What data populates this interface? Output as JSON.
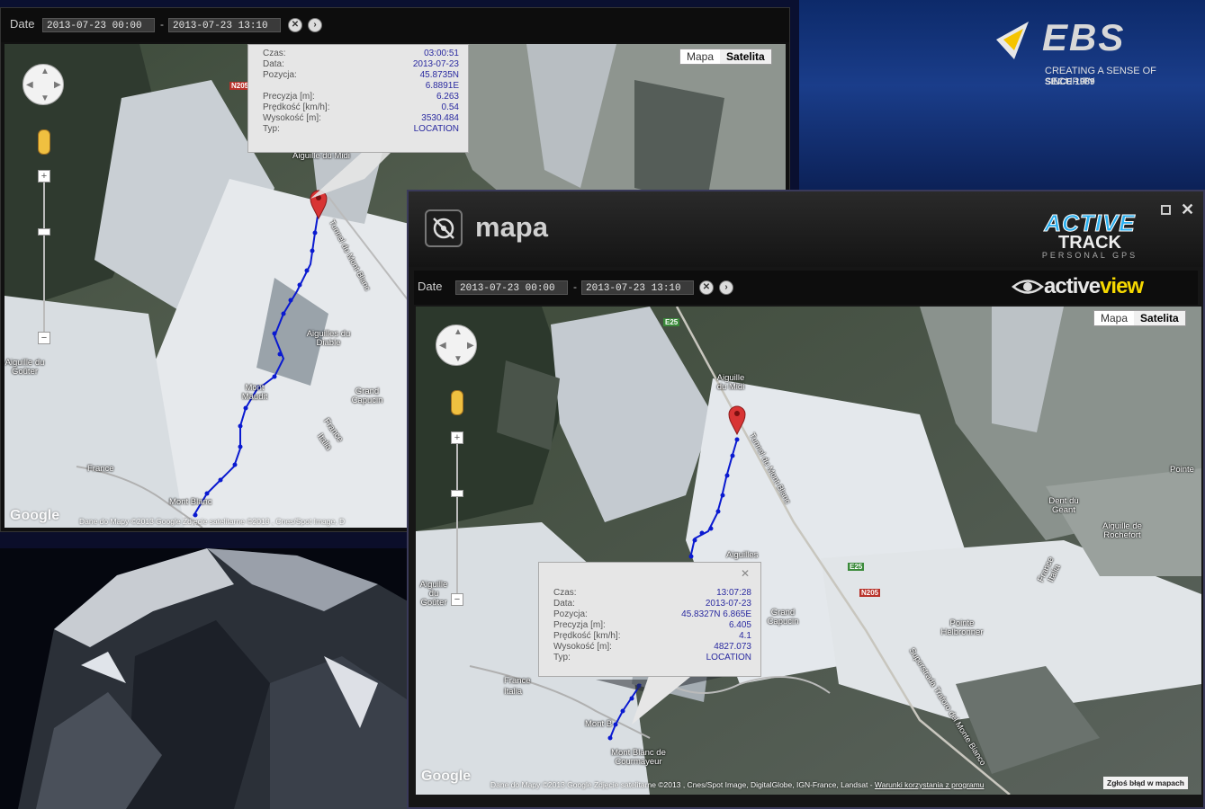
{
  "colors": {
    "accent": "#1020c8",
    "marker": "#d83434",
    "popup_bg": "#e6e6e6"
  },
  "brand": {
    "ebs_name": "EBS",
    "ebs_tagline": "CREATING A SENSE OF SECURITY",
    "ebs_since": "SINCE 1989"
  },
  "left_window": {
    "date_label": "Date",
    "date_from": "2013-07-23 00:00",
    "date_to": "2013-07-23 13:10",
    "dash": "-",
    "map_type": {
      "map": "Mapa",
      "satellite": "Satelita",
      "selected": "Satelita"
    },
    "popup": {
      "rows": [
        {
          "label": "Czas:",
          "value": "03:00:51"
        },
        {
          "label": "Data:",
          "value": "2013-07-23"
        },
        {
          "label": "Pozycja:",
          "value": "45.8735N"
        },
        {
          "label": "",
          "value": "6.8891E"
        },
        {
          "label": "Precyzja [m]:",
          "value": "6.263"
        },
        {
          "label": "Prędkość [km/h]:",
          "value": "0.54"
        },
        {
          "label": "Wysokość [m]:",
          "value": "3530.484"
        },
        {
          "label": "Typ:",
          "value": "LOCATION"
        }
      ]
    },
    "places": {
      "aiguille_midi": "Aiguille du Midi",
      "aiguilles_diable": "Aiguilles du Diable",
      "grand_capucin": "Grand Capucin",
      "aiguille_gouter": "Aiguille du Goûter",
      "mont_maudit": "Mont Maudit",
      "mont_blanc": "Mont Blanc",
      "france": "France",
      "italia": "Italia",
      "tunnel": "Tunnel du Mont-Blanc",
      "n205": "N205"
    },
    "google": "Google",
    "attribution": "Dane do Mapy ©2013 Google Zdjęcie satelitarne ©2013 , Cnes/Spot Image, D"
  },
  "main_window": {
    "title": "mapa",
    "logo_active": "ACTIVE",
    "logo_track": "TRACK",
    "logo_sub": "PERSONAL GPS",
    "activeview_1": "active",
    "activeview_2": "view",
    "date_label": "Date",
    "date_from": "2013-07-23 00:00",
    "date_to": "2013-07-23 13:10",
    "dash": "-",
    "map_type": {
      "map": "Mapa",
      "satellite": "Satelita",
      "selected": "Satelita"
    },
    "popup": {
      "rows": [
        {
          "label": "Czas:",
          "value": "13:07:28"
        },
        {
          "label": "Data:",
          "value": "2013-07-23"
        },
        {
          "label": "Pozycja:",
          "value": "45.8327N 6.865E"
        },
        {
          "label": "Precyzja [m]:",
          "value": "6.405"
        },
        {
          "label": "Prędkość [km/h]:",
          "value": "4.1"
        },
        {
          "label": "Wysokość [m]:",
          "value": "4827.073"
        },
        {
          "label": "Typ:",
          "value": "LOCATION"
        }
      ]
    },
    "places": {
      "aiguille_midi": "Aiguille du Midi",
      "aiguilles_diable": "Aiguilles",
      "grand_capucin": "Grand Capucin",
      "aiguille_gouter": "Aiguille du Goûter",
      "dent_geant": "Dent du Géant",
      "aiguille_rochefort": "Aiguille de Rochefort",
      "pointe_helbronner": "Pointe Helbronner",
      "pointe": "Pointe",
      "mont_blanc": "Mont B",
      "mont_blanc_courmayeur": "Mont Blanc de Courmayeur",
      "france": "France",
      "italia": "Italia",
      "france_italia_right": "France Italia",
      "tunnel": "Tunnel du Mont-Blanc",
      "traforo": "Superstrada Traforo del Monte Bianco",
      "e25": "E25",
      "n205": "N205"
    },
    "google": "Google",
    "attribution": "Dane do Mapy ©2013 Google Zdjęcie satelitarne ©2013 , Cnes/Spot Image, DigitalGlobe, IGN-France, Landsat - ",
    "terms_link": "Warunki korzystania z programu",
    "report_error": "Zgłoś błąd w mapach"
  }
}
